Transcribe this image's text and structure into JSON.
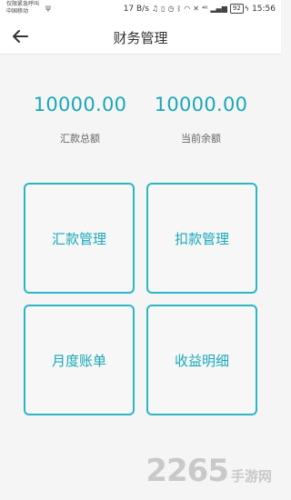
{
  "status_bar": {
    "carrier_line1": "仅限紧急呼叫",
    "carrier_line2": "中国移动",
    "usb_icon": "usb-icon",
    "speed": "17 B/s",
    "signal_text": "⁴⁶",
    "battery": "92",
    "time": "15:56"
  },
  "header": {
    "title": "财务管理",
    "back_icon": "arrow-left-icon"
  },
  "summary": {
    "remit_total_value": "10000.00",
    "remit_total_label": "汇款总额",
    "current_balance_value": "10000.00",
    "current_balance_label": "当前余额"
  },
  "tiles": [
    {
      "label": "汇款管理"
    },
    {
      "label": "扣款管理"
    },
    {
      "label": "月度账单"
    },
    {
      "label": "收益明细"
    }
  ],
  "watermark": {
    "number": "2265",
    "text": "手游网"
  },
  "colors": {
    "accent": "#1aa8b8",
    "tile_border": "#2cb6c4",
    "background": "#f5f5f5"
  }
}
